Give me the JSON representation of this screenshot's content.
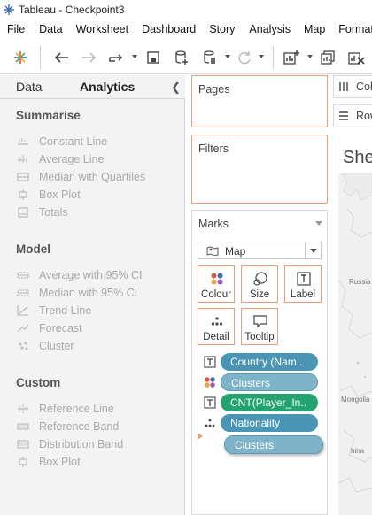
{
  "window": {
    "title": "Tableau - Checkpoint3"
  },
  "menu": [
    "File",
    "Data",
    "Worksheet",
    "Dashboard",
    "Story",
    "Analysis",
    "Map",
    "Format"
  ],
  "left_pane": {
    "tabs": [
      {
        "label": "Data"
      },
      {
        "label": "Analytics",
        "active": true
      }
    ],
    "sections": [
      {
        "title": "Summarise",
        "items": [
          {
            "label": "Constant Line",
            "icon": "constant-line-icon"
          },
          {
            "label": "Average Line",
            "icon": "average-line-icon"
          },
          {
            "label": "Median with Quartiles",
            "icon": "median-quartiles-icon"
          },
          {
            "label": "Box Plot",
            "icon": "box-plot-icon"
          },
          {
            "label": "Totals",
            "icon": "totals-icon"
          }
        ]
      },
      {
        "title": "Model",
        "items": [
          {
            "label": "Average with 95% CI",
            "icon": "average-ci-icon"
          },
          {
            "label": "Median with 95% CI",
            "icon": "median-ci-icon"
          },
          {
            "label": "Trend Line",
            "icon": "trend-line-icon"
          },
          {
            "label": "Forecast",
            "icon": "forecast-icon"
          },
          {
            "label": "Cluster",
            "icon": "cluster-icon"
          }
        ]
      },
      {
        "title": "Custom",
        "items": [
          {
            "label": "Reference Line",
            "icon": "reference-line-icon"
          },
          {
            "label": "Reference Band",
            "icon": "reference-band-icon"
          },
          {
            "label": "Distribution Band",
            "icon": "distribution-band-icon"
          },
          {
            "label": "Box Plot",
            "icon": "box-plot-icon"
          }
        ]
      }
    ]
  },
  "cards": {
    "pages": "Pages",
    "filters": "Filters"
  },
  "marks": {
    "title": "Marks",
    "mark_type": "Map",
    "buttons": [
      "Colour",
      "Size",
      "Label",
      "Detail",
      "Tooltip"
    ],
    "pills": [
      {
        "label": "Country (Nam..",
        "encoding": "label",
        "style": "blue"
      },
      {
        "label": "Clusters",
        "encoding": "colour",
        "style": "light"
      },
      {
        "label": "CNT(Player_In..",
        "encoding": "label",
        "style": "green"
      },
      {
        "label": "Nationality",
        "encoding": "detail",
        "style": "blue"
      },
      {
        "label": "Clusters",
        "encoding": "drag",
        "style": "light"
      }
    ]
  },
  "view": {
    "columns_label": "Col",
    "rows_label": "Row",
    "sheet_title": "She",
    "map_labels": [
      "Russia",
      "Mongolia",
      "hina"
    ]
  },
  "colors": {
    "accent": "#e8a07a",
    "pill_blue": "#4a95b3",
    "pill_green": "#22a370",
    "pill_light": "#7fb3c9"
  }
}
